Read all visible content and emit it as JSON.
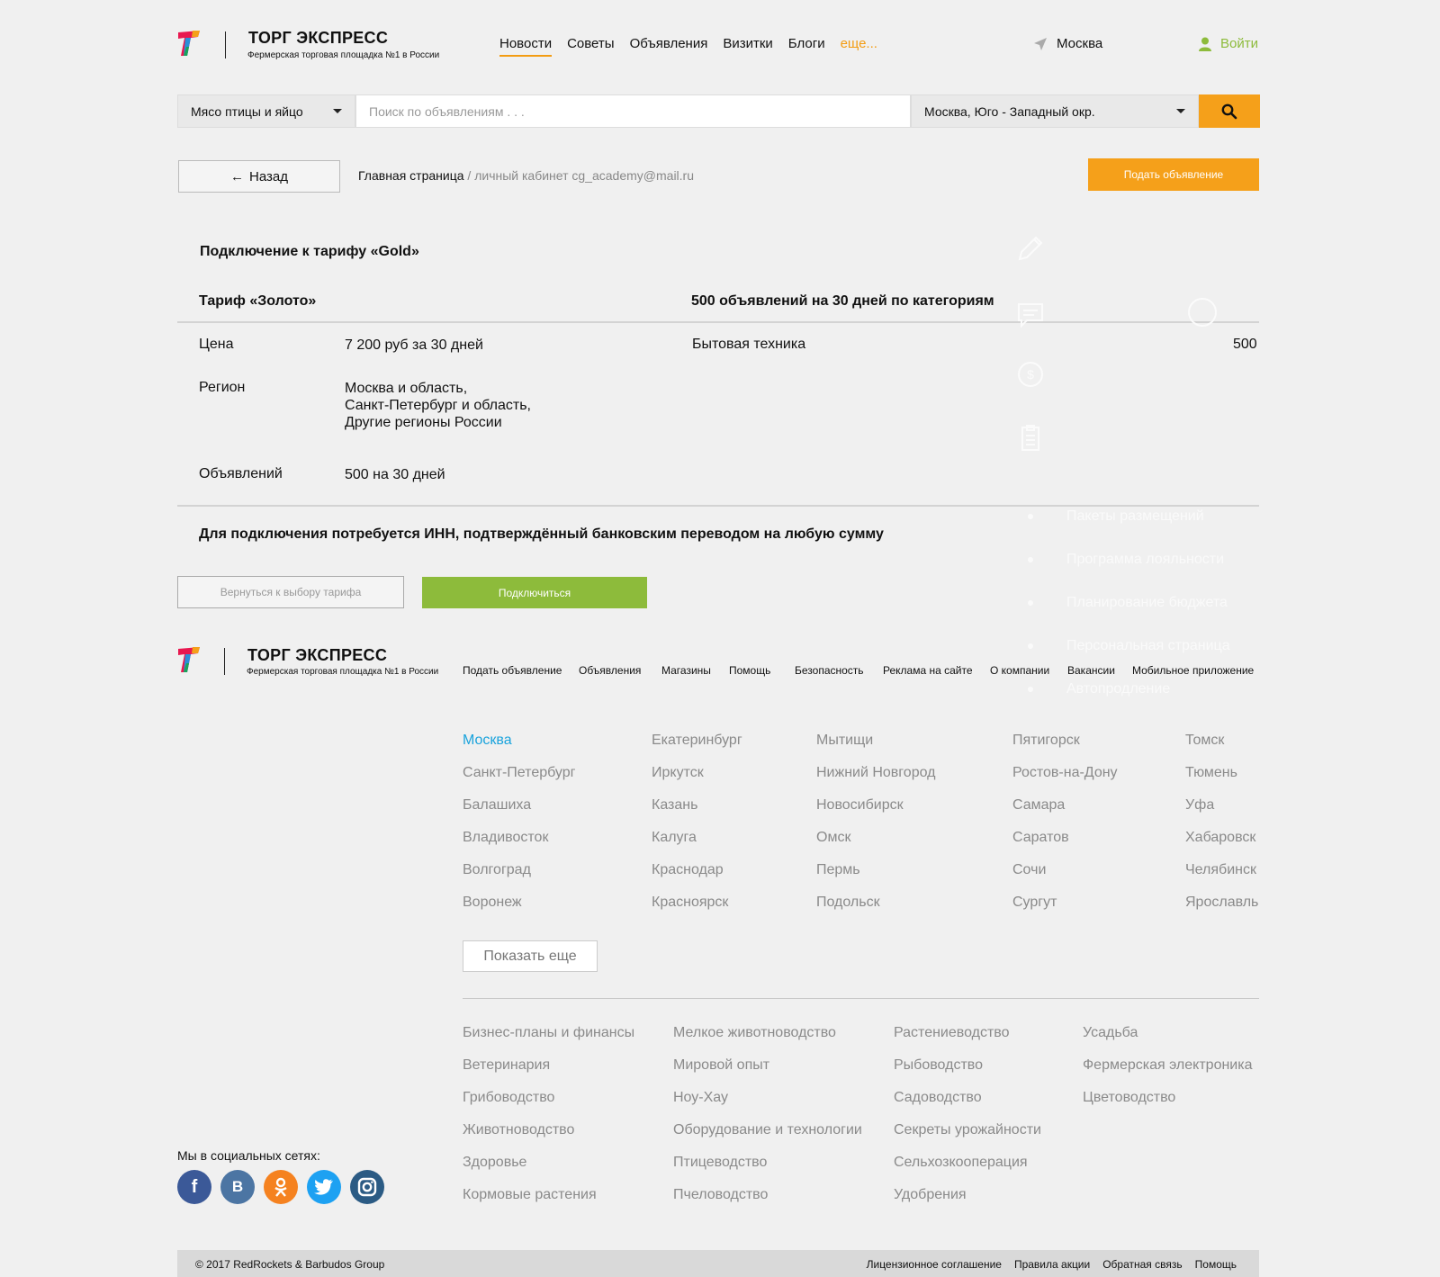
{
  "header": {
    "logo_title": "ТОРГ ЭКСПРЕСС",
    "logo_subtitle": "Фермерская торговая площадка №1 в России",
    "nav": [
      "Новости",
      "Советы",
      "Объявления",
      "Визитки",
      "Блоги"
    ],
    "nav_more": "еще...",
    "city": "Москва",
    "login": "Войти"
  },
  "search": {
    "category": "Мясо птицы и яйцо",
    "placeholder": "Поиск по объявлениям . . .",
    "region": "Москва, Юго - Западный окр."
  },
  "breadcrumb": {
    "back": "Назад",
    "home": "Главная страница",
    "current": " / личный кабинет cg_academy@mail.ru",
    "post_ad": "Подать объявление"
  },
  "tariff": {
    "heading": "Подключение к тарифу «Gold»",
    "name": "Тариф «Золото»",
    "categories_title": "500 объявлений на 30 дней по категориям",
    "price_label": "Цена",
    "price_value": "7 200 руб за 30 дней",
    "region_label": "Регион",
    "region_lines": [
      "Москва и область,",
      "Санкт-Петербург и область,",
      "Другие регионы России"
    ],
    "ads_label": "Объявлений",
    "ads_value": "500 на 30 дней",
    "category_item": "Бытовая техника",
    "category_count": "500",
    "inn_note": "Для подключения потребуется ИНН, подтверждённый банковским переводом на любую сумму",
    "return_button": "Вернуться к выбору тарифа",
    "connect_button": "Подключиться"
  },
  "side_menu": [
    "Пакеты размещений",
    "Программа лояльности",
    "Планирование бюджета",
    "Персональная страница",
    "Автопродление"
  ],
  "footer": {
    "links": [
      "Подать объявление",
      "Объявления",
      "Магазины",
      "Помощь",
      "Безопасность",
      "Реклама на сайте",
      "О компании",
      "Вакансии",
      "Мобильное приложение"
    ],
    "cities": [
      [
        "Москва",
        "Санкт-Петербург",
        "Балашиха",
        "Владивосток",
        "Волгоград",
        "Воронеж"
      ],
      [
        "Екатеринбург",
        "Иркутск",
        "Казань",
        "Калуга",
        "Краснодар",
        "Красноярск"
      ],
      [
        "Мытищи",
        "Нижний Новгород",
        "Новосибирск",
        "Омск",
        "Пермь",
        "Подольск"
      ],
      [
        "Пятигорск",
        "Ростов-на-Дону",
        "Самара",
        "Саратов",
        "Сочи",
        "Сургут"
      ],
      [
        "Томск",
        "Тюмень",
        "Уфа",
        "Хабаровск",
        "Челябинск",
        "Ярославль"
      ]
    ],
    "show_more": "Показать еще",
    "topics": [
      [
        "Бизнес-планы и финансы",
        "Ветеринария",
        "Грибоводство",
        "Животноводство",
        "Здоровье",
        "Кормовые растения"
      ],
      [
        "Мелкое животноводство",
        "Мировой опыт",
        "Ноу-Хау",
        "Оборудование и технологии",
        "Птицеводство",
        "Пчеловодство"
      ],
      [
        "Растениеводство",
        "Рыбоводство",
        "Садоводство",
        "Секреты урожайности",
        "Сельхозкооперация",
        "Удобрения"
      ],
      [
        "Усадьба",
        "Фермерская электроника",
        "Цветоводство"
      ]
    ],
    "social_title": "Мы в социальных сетях:",
    "social": [
      "f",
      "В",
      "ok",
      "tw",
      "ig"
    ],
    "copyright": "© 2017 RedRockets & Barbudos Group",
    "bottom_links": [
      "Лицензионное соглашение",
      "Правила акции",
      "Обратная связь",
      "Помощь"
    ]
  },
  "colors": {
    "accent_orange": "#f5a01a",
    "accent_green": "#8dbb3b",
    "active_city": "#1aa3dc"
  }
}
